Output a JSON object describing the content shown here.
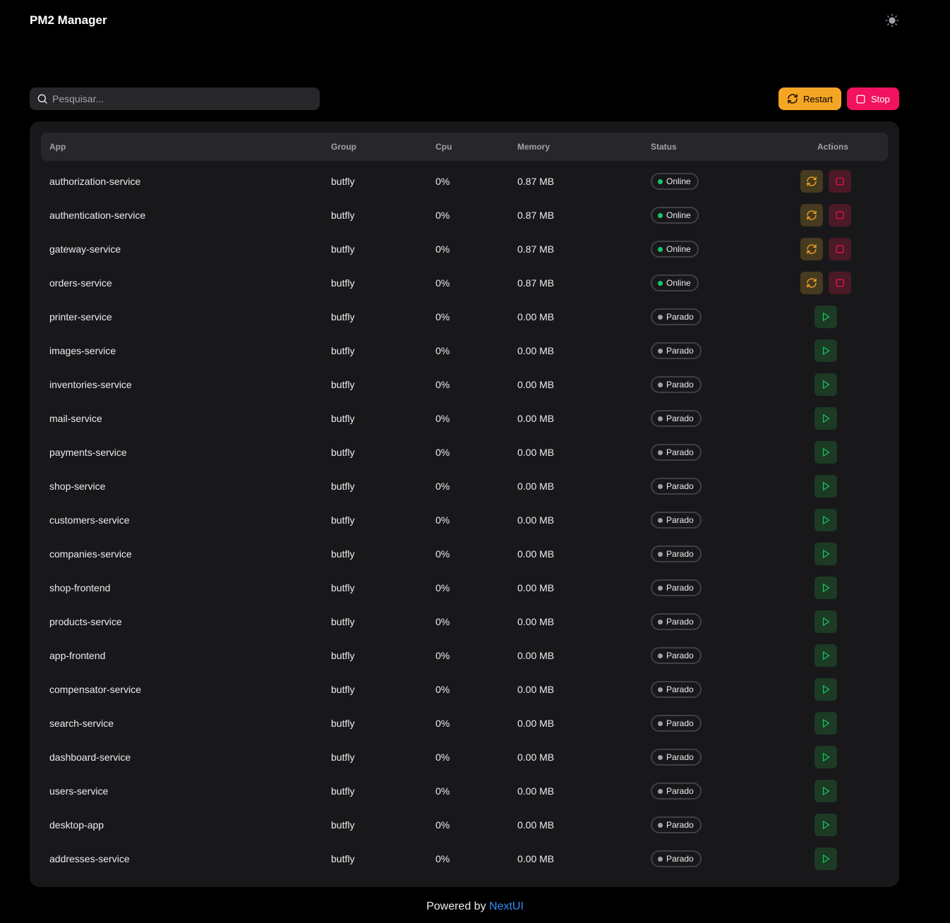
{
  "header": {
    "title": "PM2 Manager",
    "theme_icon": "sun-icon"
  },
  "toolbar": {
    "search_placeholder": "Pesquisar...",
    "restart_label": "Restart",
    "stop_label": "Stop"
  },
  "table": {
    "columns": [
      "App",
      "Group",
      "Cpu",
      "Memory",
      "Status",
      "Actions"
    ],
    "rows": [
      {
        "app": "authorization-service",
        "group": "butfly",
        "cpu": "0%",
        "memory": "0.87 MB",
        "status": "Online"
      },
      {
        "app": "authentication-service",
        "group": "butfly",
        "cpu": "0%",
        "memory": "0.87 MB",
        "status": "Online"
      },
      {
        "app": "gateway-service",
        "group": "butfly",
        "cpu": "0%",
        "memory": "0.87 MB",
        "status": "Online"
      },
      {
        "app": "orders-service",
        "group": "butfly",
        "cpu": "0%",
        "memory": "0.87 MB",
        "status": "Online"
      },
      {
        "app": "printer-service",
        "group": "butfly",
        "cpu": "0%",
        "memory": "0.00 MB",
        "status": "Parado"
      },
      {
        "app": "images-service",
        "group": "butfly",
        "cpu": "0%",
        "memory": "0.00 MB",
        "status": "Parado"
      },
      {
        "app": "inventories-service",
        "group": "butfly",
        "cpu": "0%",
        "memory": "0.00 MB",
        "status": "Parado"
      },
      {
        "app": "mail-service",
        "group": "butfly",
        "cpu": "0%",
        "memory": "0.00 MB",
        "status": "Parado"
      },
      {
        "app": "payments-service",
        "group": "butfly",
        "cpu": "0%",
        "memory": "0.00 MB",
        "status": "Parado"
      },
      {
        "app": "shop-service",
        "group": "butfly",
        "cpu": "0%",
        "memory": "0.00 MB",
        "status": "Parado"
      },
      {
        "app": "customers-service",
        "group": "butfly",
        "cpu": "0%",
        "memory": "0.00 MB",
        "status": "Parado"
      },
      {
        "app": "companies-service",
        "group": "butfly",
        "cpu": "0%",
        "memory": "0.00 MB",
        "status": "Parado"
      },
      {
        "app": "shop-frontend",
        "group": "butfly",
        "cpu": "0%",
        "memory": "0.00 MB",
        "status": "Parado"
      },
      {
        "app": "products-service",
        "group": "butfly",
        "cpu": "0%",
        "memory": "0.00 MB",
        "status": "Parado"
      },
      {
        "app": "app-frontend",
        "group": "butfly",
        "cpu": "0%",
        "memory": "0.00 MB",
        "status": "Parado"
      },
      {
        "app": "compensator-service",
        "group": "butfly",
        "cpu": "0%",
        "memory": "0.00 MB",
        "status": "Parado"
      },
      {
        "app": "search-service",
        "group": "butfly",
        "cpu": "0%",
        "memory": "0.00 MB",
        "status": "Parado"
      },
      {
        "app": "dashboard-service",
        "group": "butfly",
        "cpu": "0%",
        "memory": "0.00 MB",
        "status": "Parado"
      },
      {
        "app": "users-service",
        "group": "butfly",
        "cpu": "0%",
        "memory": "0.00 MB",
        "status": "Parado"
      },
      {
        "app": "desktop-app",
        "group": "butfly",
        "cpu": "0%",
        "memory": "0.00 MB",
        "status": "Parado"
      },
      {
        "app": "addresses-service",
        "group": "butfly",
        "cpu": "0%",
        "memory": "0.00 MB",
        "status": "Parado"
      }
    ]
  },
  "footer": {
    "prefix": "Powered by ",
    "link": "NextUI"
  },
  "colors": {
    "background": "#000000",
    "card": "#18181B",
    "warning": "#F5A524",
    "danger": "#F31260",
    "success": "#17C964",
    "link": "#338EF7"
  }
}
